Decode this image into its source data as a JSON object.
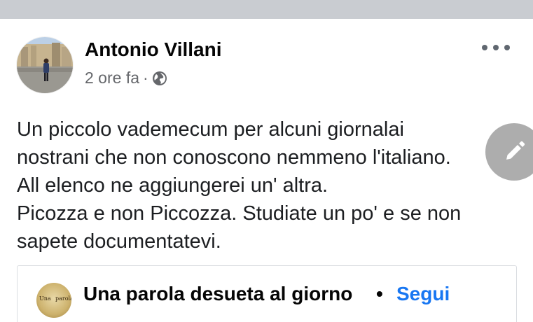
{
  "post": {
    "author": "Antonio Villani",
    "time": "2 ore fa",
    "separator": "·",
    "privacy_icon": "globe-icon",
    "more_icon": "more-options-icon",
    "lines": [
      "Un piccolo vademecum per alcuni giornalai",
      "nostrani che non conoscono nemmeno l'italiano.",
      "All elenco ne aggiungerei un' altra.",
      "Picozza e non Piccozza. Studiate un po' e se non",
      "sapete documentatevi."
    ]
  },
  "floating_action": {
    "icon": "pencil-icon"
  },
  "shared_page": {
    "avatar_text_left": "Una",
    "avatar_text_right": "parola",
    "title": "Una parola desueta al giorno",
    "separator": "•",
    "follow_label": "Segui"
  },
  "colors": {
    "link": "#1877f2",
    "secondary_text": "#65676b",
    "background_gap": "#c9ccd1"
  }
}
